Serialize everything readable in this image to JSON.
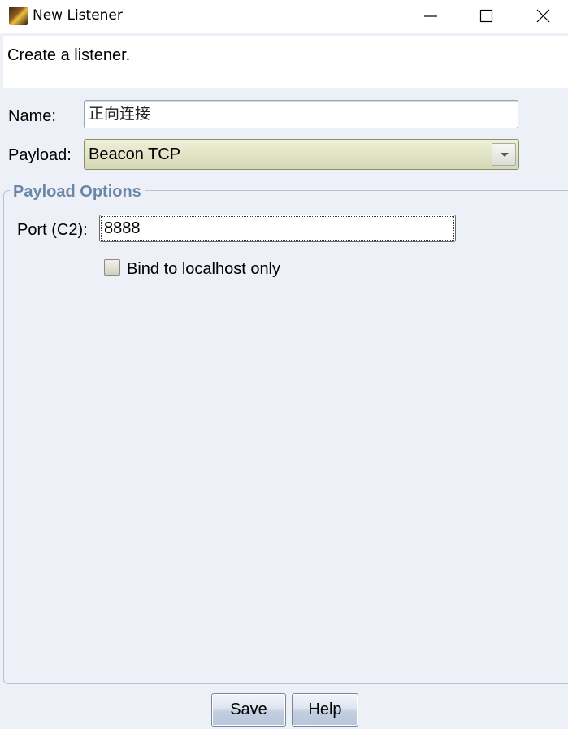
{
  "window": {
    "title": "New Listener",
    "icon": "app-icon",
    "controls": {
      "minimize": "minimize-icon",
      "maximize": "maximize-icon",
      "close": "close-icon"
    }
  },
  "description": "Create a listener.",
  "form": {
    "name_label": "Name:",
    "name_value": "正向连接",
    "payload_label": "Payload:",
    "payload_value": "Beacon TCP"
  },
  "payload_options": {
    "title": "Payload Options",
    "port_label": "Port (C2):",
    "port_value": "8888",
    "bind_localhost_label": "Bind to localhost only",
    "bind_localhost_checked": false
  },
  "buttons": {
    "save": "Save",
    "help": "Help"
  },
  "colors": {
    "background": "#eef0f8",
    "group_title": "#6b87a8",
    "dropdown_bg": "#d5d8b5"
  }
}
